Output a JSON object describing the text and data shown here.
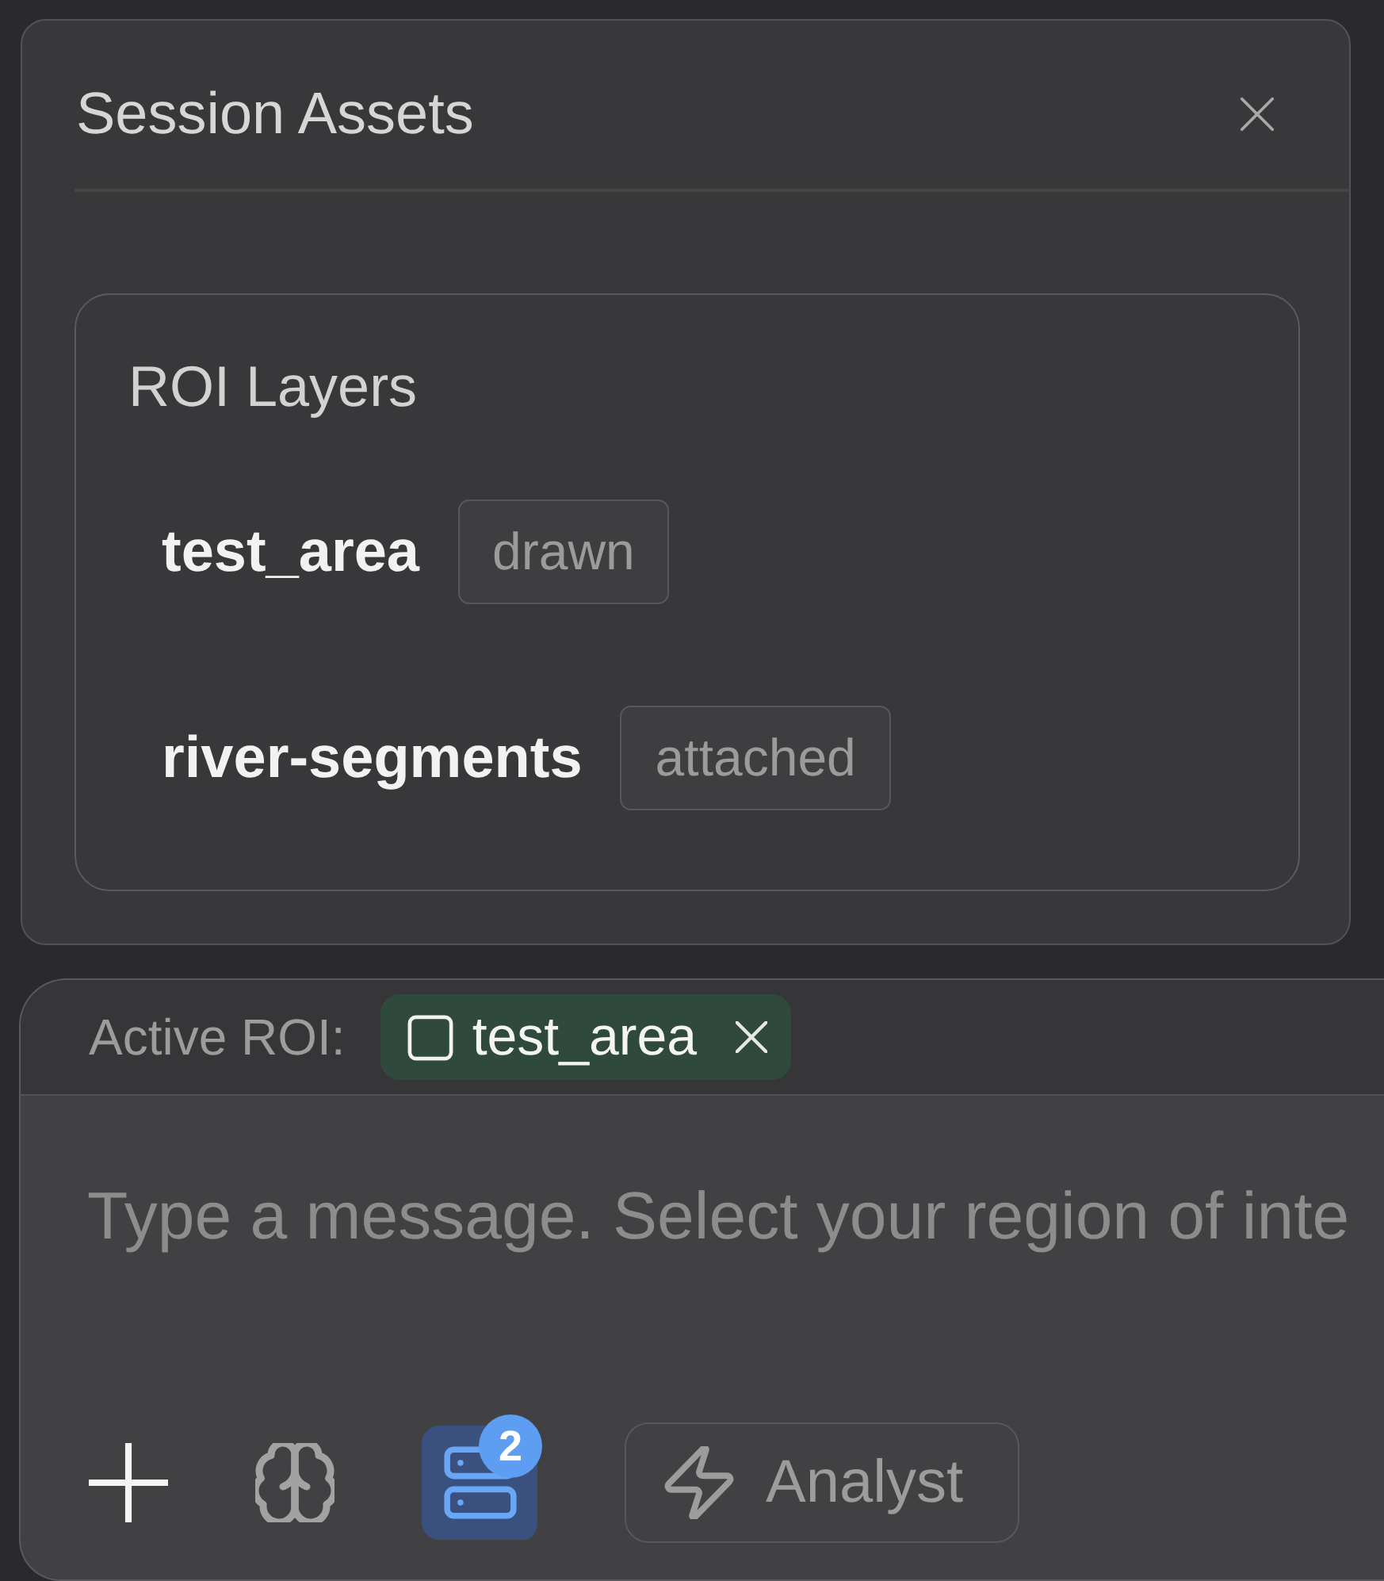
{
  "assets_panel": {
    "title": "Session Assets",
    "roi_layers": {
      "title": "ROI Layers",
      "items": [
        {
          "name": "test_area",
          "tag": "drawn"
        },
        {
          "name": "river-segments",
          "tag": "attached"
        }
      ]
    }
  },
  "composer": {
    "active_roi_label": "Active ROI:",
    "active_roi": {
      "name": "test_area"
    },
    "placeholder": "Type a message. Select your region of inte",
    "tools": [
      {
        "kind": "add",
        "active": false
      },
      {
        "kind": "brain",
        "active": false
      },
      {
        "kind": "data",
        "active": true,
        "badge": "2"
      }
    ],
    "mode_button": {
      "label": "Analyst"
    }
  }
}
